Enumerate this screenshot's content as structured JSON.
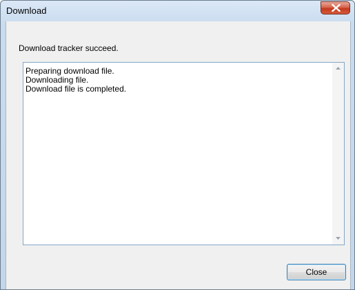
{
  "window": {
    "title": "Download",
    "close_icon": "close-x-icon"
  },
  "message": "Download tracker succeed.",
  "log": {
    "lines": [
      "Preparing download file.",
      "Downloading file.",
      "Download file is completed."
    ]
  },
  "scrollbar": {
    "up_icon": "scroll-up-arrow-icon",
    "down_icon": "scroll-down-arrow-icon"
  },
  "buttons": {
    "close_label": "Close"
  },
  "colors": {
    "titlebar": "#c9dcef",
    "client_background": "#f0f0f0",
    "close_x": "#c23a1e",
    "log_border": "#82a6c8",
    "button_border": "#3c7fb1"
  }
}
